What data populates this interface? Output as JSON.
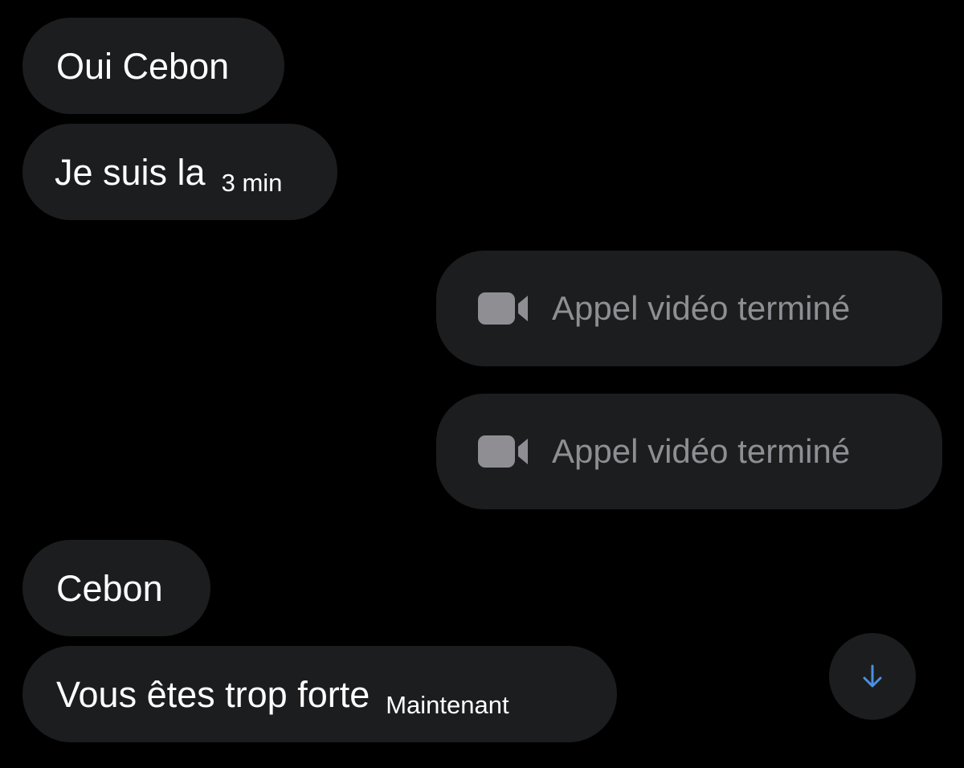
{
  "colors": {
    "background": "#000000",
    "bubble": "#1c1d1f",
    "text": "#ffffff",
    "muted": "#8e8e93",
    "accent": "#4a90e2"
  },
  "messages": [
    {
      "text": "Oui Cebon",
      "time": ""
    },
    {
      "text": "Je suis la",
      "time": "3 min"
    },
    {
      "text": "Cebon",
      "time": ""
    },
    {
      "text": "Vous êtes trop forte",
      "time": "Maintenant"
    }
  ],
  "calls": [
    {
      "icon": "video-camera-icon",
      "label": "Appel vidéo terminé"
    },
    {
      "icon": "video-camera-icon",
      "label": "Appel vidéo terminé"
    }
  ],
  "scroll_button": {
    "icon": "arrow-down-icon"
  }
}
